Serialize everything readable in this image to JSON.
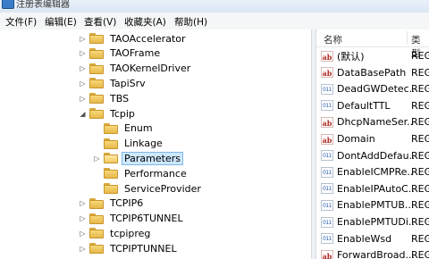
{
  "window": {
    "title": "注册表编辑器"
  },
  "menu": [
    "文件(F)",
    "编辑(E)",
    "查看(V)",
    "收藏夹(A)",
    "帮助(H)"
  ],
  "tree": [
    {
      "label": "TAOAccelerator",
      "expander": "▷",
      "depth": 0
    },
    {
      "label": "TAOFrame",
      "expander": "▷",
      "depth": 0
    },
    {
      "label": "TAOKernelDriver",
      "expander": "▷",
      "depth": 0
    },
    {
      "label": "TapiSrv",
      "expander": "▷",
      "depth": 0
    },
    {
      "label": "TBS",
      "expander": "▷",
      "depth": 0
    },
    {
      "label": "Tcpip",
      "expander": "◢",
      "depth": 0
    },
    {
      "label": "Enum",
      "expander": "",
      "depth": 1
    },
    {
      "label": "Linkage",
      "expander": "",
      "depth": 1
    },
    {
      "label": "Parameters",
      "expander": "▷",
      "depth": 1,
      "selected": true
    },
    {
      "label": "Performance",
      "expander": "",
      "depth": 1
    },
    {
      "label": "ServiceProvider",
      "expander": "",
      "depth": 1
    },
    {
      "label": "TCPIP6",
      "expander": "▷",
      "depth": 0
    },
    {
      "label": "TCPIP6TUNNEL",
      "expander": "▷",
      "depth": 0
    },
    {
      "label": "tcpipreg",
      "expander": "▷",
      "depth": 0
    },
    {
      "label": "TCPIPTUNNEL",
      "expander": "▷",
      "depth": 0
    }
  ],
  "list": {
    "headers": {
      "name": "名称",
      "type": "类型"
    },
    "rows": [
      {
        "icon": "string-value-icon",
        "name": "(默认)",
        "type": "REG"
      },
      {
        "icon": "string-value-icon",
        "name": "DataBasePath",
        "type": "REG"
      },
      {
        "icon": "dword-value-icon",
        "name": "DeadGWDetec...",
        "type": "REG"
      },
      {
        "icon": "dword-value-icon",
        "name": "DefaultTTL",
        "type": "REG"
      },
      {
        "icon": "string-value-icon",
        "name": "DhcpNameSer...",
        "type": "REG"
      },
      {
        "icon": "string-value-icon",
        "name": "Domain",
        "type": "REG"
      },
      {
        "icon": "dword-value-icon",
        "name": "DontAddDefau...",
        "type": "REG"
      },
      {
        "icon": "dword-value-icon",
        "name": "EnableICMPRe...",
        "type": "REG"
      },
      {
        "icon": "dword-value-icon",
        "name": "EnableIPAutoC...",
        "type": "REG"
      },
      {
        "icon": "dword-value-icon",
        "name": "EnablePMTUB...",
        "type": "REG"
      },
      {
        "icon": "dword-value-icon",
        "name": "EnablePMTUDi...",
        "type": "REG"
      },
      {
        "icon": "dword-value-icon",
        "name": "EnableWsd",
        "type": "REG"
      },
      {
        "icon": "string-value-icon",
        "name": "ForwardBroad...",
        "type": "REG"
      }
    ]
  }
}
